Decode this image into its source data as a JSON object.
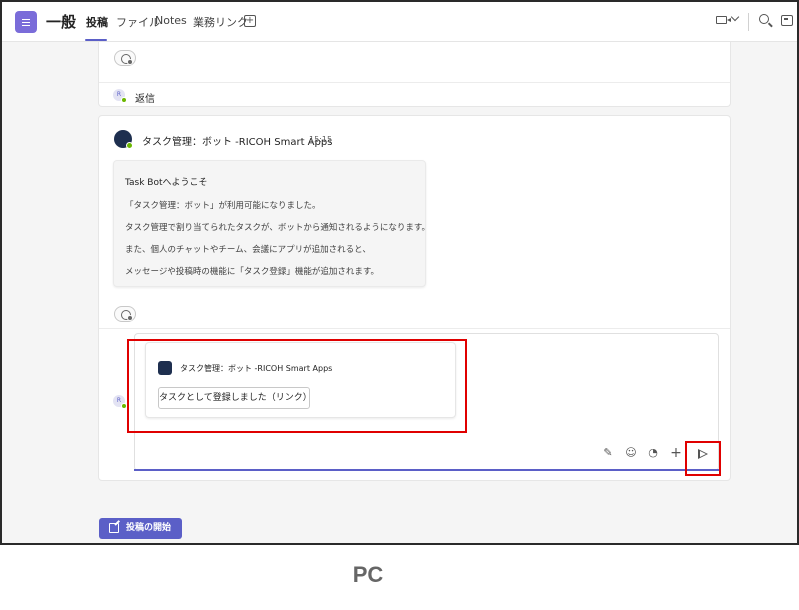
{
  "header": {
    "channel_name": "一般",
    "tabs": [
      {
        "label": "投稿",
        "active": true
      },
      {
        "label": "ファイル",
        "active": false
      },
      {
        "label": "Notes",
        "active": false
      },
      {
        "label": "業務リンク",
        "active": false
      }
    ],
    "add_tab_glyph": "+",
    "icons": [
      "team-icon",
      "video-call-icon",
      "chevron-down-icon",
      "search-icon",
      "side-panel-icon"
    ]
  },
  "thread1": {
    "reply_label": "返信",
    "avatar_initial": "R"
  },
  "thread2": {
    "bot_name": "タスク管理：ボット -RICOH Smart Apps",
    "time": "15:15",
    "welcome_title": "Task Botへようこそ",
    "welcome_lines": [
      "「タスク管理：ボット」が利用可能になりました。",
      "タスク管理で割り当てられたタスクが、ボットから通知されるようになります。",
      "また、個人のチャットやチーム、会議にアプリが追加されると、",
      "メッセージや投稿時の機能に「タスク登録」機能が追加されます。"
    ]
  },
  "compose": {
    "avatar_initial": "R",
    "preview_app_name": "タスク管理：ボット -RICOH Smart Apps",
    "preview_button_label": "タスクとして登録しました（リンク）",
    "tools": [
      "format-icon",
      "emoji-icon",
      "loop-icon",
      "plus-icon",
      "send-icon"
    ]
  },
  "new_post_label": "投稿の開始",
  "caption": "PC",
  "colors": {
    "accent": "#5b5fc7",
    "highlight": "#e00000",
    "presence": "#6bb700"
  }
}
